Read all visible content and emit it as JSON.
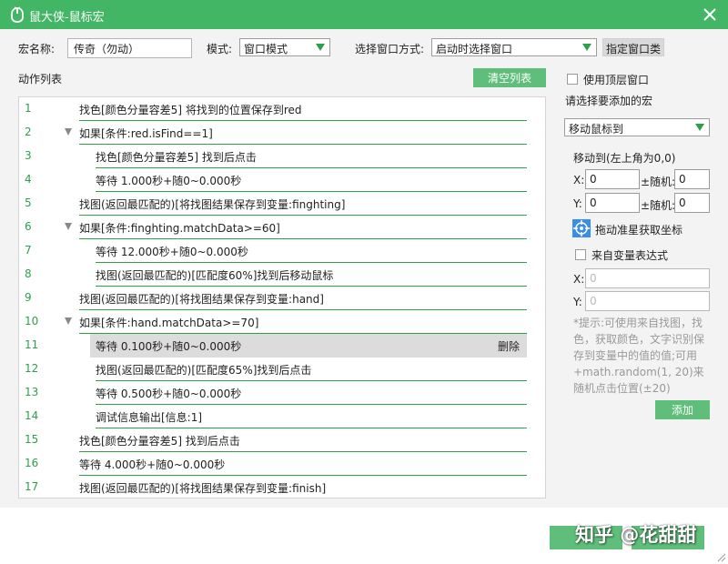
{
  "window": {
    "title": "鼠大侠-鼠标宏"
  },
  "form": {
    "macro_name_label": "宏名称:",
    "macro_name_value": "传奇（勿动）",
    "mode_label": "模式:",
    "mode_value": "窗口模式",
    "select_window_label": "选择窗口方式:",
    "select_window_value": "启动时选择窗口",
    "specify_window_class": "指定窗口类"
  },
  "actions": {
    "label": "动作列表",
    "clear_button": "清空列表",
    "delete_label": "删除",
    "rows": [
      {
        "num": "1",
        "text": "找色[颜色分量容差5] 将找到的位置保存到red",
        "indent": 0,
        "collapsible": false,
        "selected": false
      },
      {
        "num": "2",
        "text": "如果[条件:red.isFind==1]",
        "indent": 0,
        "collapsible": true,
        "selected": false
      },
      {
        "num": "3",
        "text": "找色[颜色分量容差5] 找到后点击",
        "indent": 1,
        "collapsible": false,
        "selected": false
      },
      {
        "num": "4",
        "text": "等待 1.000秒+随0~0.000秒",
        "indent": 1,
        "collapsible": false,
        "selected": false
      },
      {
        "num": "5",
        "text": "找图(返回最匹配的)[将找图结果保存到变量:finghting]",
        "indent": 0,
        "collapsible": false,
        "selected": false
      },
      {
        "num": "6",
        "text": "如果[条件:finghting.matchData>=60]",
        "indent": 0,
        "collapsible": true,
        "selected": false
      },
      {
        "num": "7",
        "text": "等待 12.000秒+随0~0.000秒",
        "indent": 1,
        "collapsible": false,
        "selected": false
      },
      {
        "num": "8",
        "text": "找图(返回最匹配的)[匹配度60%]找到后移动鼠标",
        "indent": 1,
        "collapsible": false,
        "selected": false
      },
      {
        "num": "9",
        "text": "找图(返回最匹配的)[将找图结果保存到变量:hand]",
        "indent": 0,
        "collapsible": false,
        "selected": false
      },
      {
        "num": "10",
        "text": "如果[条件:hand.matchData>=70]",
        "indent": 0,
        "collapsible": true,
        "selected": false
      },
      {
        "num": "11",
        "text": "等待 0.100秒+随0~0.000秒",
        "indent": 1,
        "collapsible": false,
        "selected": true
      },
      {
        "num": "12",
        "text": "找图(返回最匹配的)[匹配度65%]找到后点击",
        "indent": 1,
        "collapsible": false,
        "selected": false
      },
      {
        "num": "13",
        "text": "等待 0.500秒+随0~0.000秒",
        "indent": 1,
        "collapsible": false,
        "selected": false
      },
      {
        "num": "14",
        "text": "调试信息输出[信息:1]",
        "indent": 1,
        "collapsible": false,
        "selected": false
      },
      {
        "num": "15",
        "text": "找色[颜色分量容差5] 找到后点击",
        "indent": 0,
        "collapsible": false,
        "selected": false
      },
      {
        "num": "16",
        "text": "等待 4.000秒+随0~0.000秒",
        "indent": 0,
        "collapsible": false,
        "selected": false
      },
      {
        "num": "17",
        "text": "找图(返回最匹配的)[将找图结果保存到变量:finish]",
        "indent": 0,
        "collapsible": false,
        "selected": false
      }
    ]
  },
  "right_panel": {
    "use_top_window": "使用顶层窗口",
    "select_macro_label": "请选择要添加的宏",
    "macro_select_value": "移动鼠标到",
    "move_to_label": "移动到(左上角为0,0)",
    "x_label": "X:",
    "x_value": "0",
    "x_random_label": "±随机:",
    "x_random_value": "0",
    "y_label": "Y:",
    "y_value": "0",
    "y_random_label": "±随机:",
    "y_random_value": "0",
    "drag_crosshair": "拖动准星获取坐标",
    "from_var_expr": "来自变量表达式",
    "var_x_label": "X:",
    "var_x_placeholder": "0",
    "var_y_label": "Y:",
    "var_y_placeholder": "0",
    "hint": "*提示:可使用来自找图，找色，获取颜色，文字识别保存到变量中的值的值;可用+math.random(1, 20)来随机点击位置(±20)",
    "add_button": "添加"
  },
  "footer": {
    "watermark": "知乎 @花甜甜"
  },
  "colors": {
    "brand_green": "#43b665",
    "button_green": "#5fbf7a",
    "accent_green": "#2e9e4f",
    "selected_row": "#dcdcdc"
  }
}
